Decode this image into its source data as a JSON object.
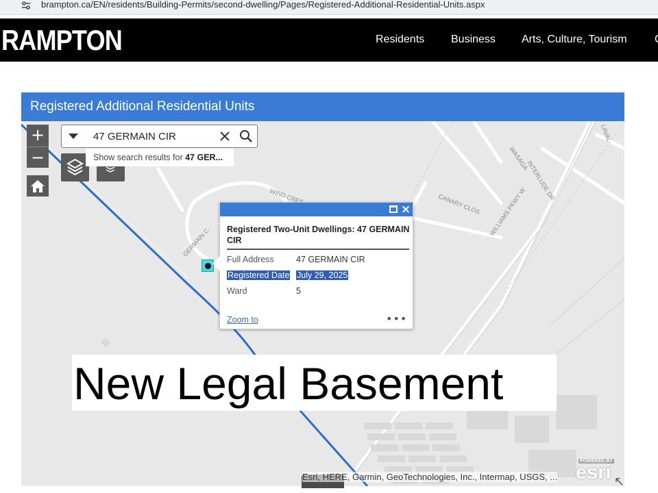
{
  "browser": {
    "url": "brampton.ca/EN/residents/Building-Permits/second-dwelling/Pages/Registered-Additional-Residential-Units.aspx"
  },
  "site_nav": {
    "logo": "RAMPTON",
    "items": [
      {
        "label": "Residents"
      },
      {
        "label": "Business"
      },
      {
        "label": "Arts, Culture, Tourism"
      },
      {
        "label": "C"
      }
    ]
  },
  "app": {
    "title": "Registered Additional Residential Units",
    "header_color": "#3a7bd5"
  },
  "search": {
    "value": "47 GERMAIN CIR",
    "suggestion_prefix": "Show search results for ",
    "suggestion_term": "47 GER..."
  },
  "map_labels": {
    "wasaga": "WASAGA",
    "interlude": "INTERLUDE DR",
    "canary": "CANARY CLOS",
    "williams": "WILLIAMS PKWY W",
    "wind": "WIND CRES",
    "germain": "GERMAIN C",
    "laval": "LAVAL"
  },
  "popup": {
    "title": "Registered Two-Unit Dwellings: 47 GERMAIN CIR",
    "fields": [
      {
        "label": "Full Address",
        "value": "47 GERMAIN CIR"
      },
      {
        "label": "Registered Date",
        "value": "July 29, 2025"
      },
      {
        "label": "Ward",
        "value": "5"
      }
    ],
    "zoom_link": "Zoom to",
    "more": "•••"
  },
  "overlay_caption": "New Legal Basement",
  "attribution": "Esri, HERE, Garmin, GeoTechnologies, Inc., Intermap, USGS, ...",
  "esri_logo": {
    "powered": "POWERED BY",
    "word": "esri"
  }
}
